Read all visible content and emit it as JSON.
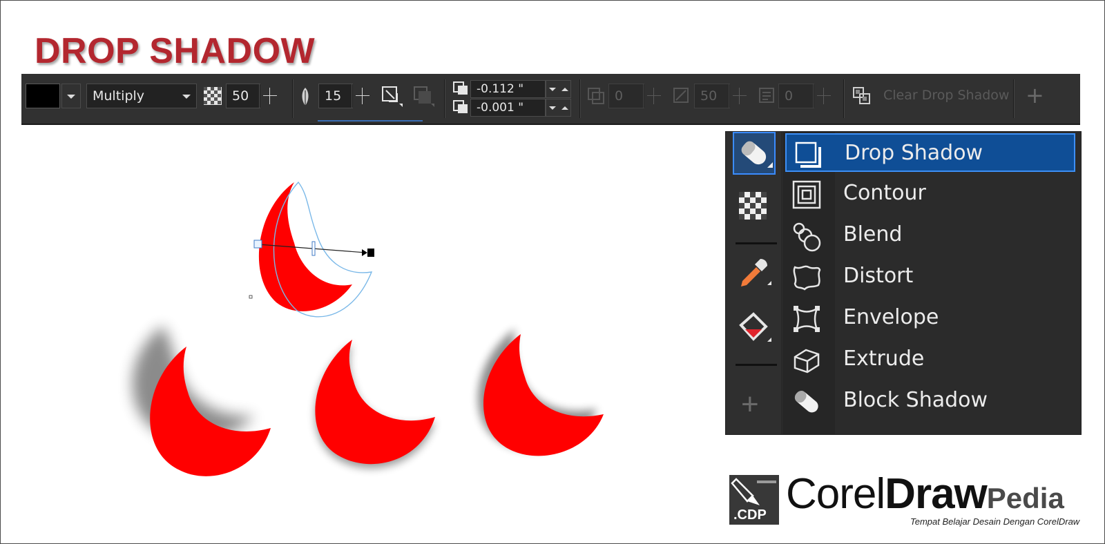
{
  "page": {
    "title": "DROP SHADOW"
  },
  "propbar": {
    "shadow_color": "#000000",
    "merge_mode": "Multiply",
    "opacity": "50",
    "feather": "15",
    "offset_x": "-0.112 \"",
    "offset_y": "-0.001 \"",
    "angle": "0",
    "stretch": "50",
    "fade": "0",
    "clear_label": "Clear Drop Shadow",
    "add_label": "+"
  },
  "flyout": {
    "items": [
      {
        "label": "Drop Shadow",
        "icon": "drop-shadow-icon",
        "selected": true
      },
      {
        "label": "Contour",
        "icon": "contour-icon"
      },
      {
        "label": "Blend",
        "icon": "blend-icon"
      },
      {
        "label": "Distort",
        "icon": "distort-icon"
      },
      {
        "label": "Envelope",
        "icon": "envelope-icon"
      },
      {
        "label": "Extrude",
        "icon": "extrude-icon"
      },
      {
        "label": "Block Shadow",
        "icon": "block-shadow-icon"
      }
    ],
    "add_tool_label": "+"
  },
  "logo": {
    "badge": ".CDP",
    "brand_corel": "Corel",
    "brand_draw": "Draw",
    "brand_pedia": "Pedia",
    "tagline": "Tempat Belajar Desain Dengan CorelDraw"
  },
  "colors": {
    "title": "#b3272f",
    "moon": "#ff0000",
    "toolbar": "#313131",
    "selection": "#0f4e96"
  }
}
